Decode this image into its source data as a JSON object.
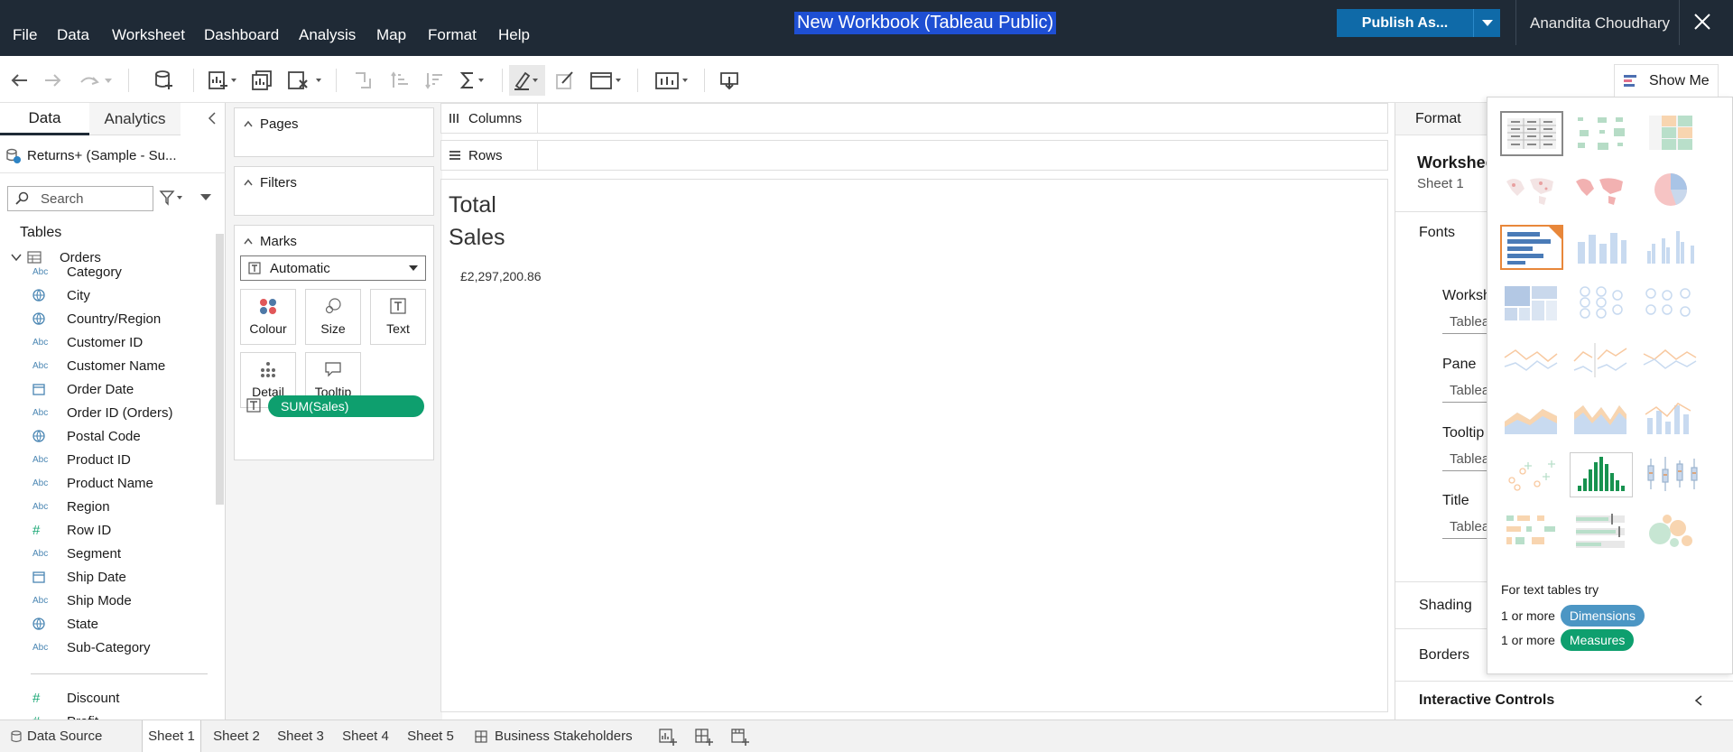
{
  "menu": [
    "File",
    "Data",
    "Worksheet",
    "Dashboard",
    "Analysis",
    "Map",
    "Format",
    "Help"
  ],
  "title": "New Workbook (Tableau Public)",
  "publish_label": "Publish As...",
  "user_name": "Anandita Choudhary",
  "show_me_label": "Show Me",
  "left_tabs": {
    "data": "Data",
    "analytics": "Analytics"
  },
  "datasource": "Returns+ (Sample - Su...",
  "search_placeholder": "Search",
  "tables_label": "Tables",
  "table_name": "Orders",
  "fields": [
    {
      "type": "Abc",
      "name": "Category"
    },
    {
      "type": "globe",
      "name": "City"
    },
    {
      "type": "globe",
      "name": "Country/Region"
    },
    {
      "type": "Abc",
      "name": "Customer ID"
    },
    {
      "type": "Abc",
      "name": "Customer Name"
    },
    {
      "type": "calendar",
      "name": "Order Date"
    },
    {
      "type": "Abc",
      "name": "Order ID (Orders)"
    },
    {
      "type": "globe",
      "name": "Postal Code"
    },
    {
      "type": "Abc",
      "name": "Product ID"
    },
    {
      "type": "Abc",
      "name": "Product Name"
    },
    {
      "type": "Abc",
      "name": "Region"
    },
    {
      "type": "#",
      "name": "Row ID"
    },
    {
      "type": "Abc",
      "name": "Segment"
    },
    {
      "type": "calendar",
      "name": "Ship Date"
    },
    {
      "type": "Abc",
      "name": "Ship Mode"
    },
    {
      "type": "globe",
      "name": "State"
    },
    {
      "type": "Abc",
      "name": "Sub-Category"
    },
    {
      "type": "#",
      "name": "Discount"
    },
    {
      "type": "#",
      "name": "Profit"
    }
  ],
  "cards": {
    "pages": "Pages",
    "filters": "Filters",
    "marks": "Marks",
    "mark_type": "Automatic"
  },
  "mark_buttons": {
    "colour": "Colour",
    "size": "Size",
    "text": "Text",
    "detail": "Detail",
    "tooltip": "Tooltip"
  },
  "pill": "SUM(Sales)",
  "shelves": {
    "columns": "Columns",
    "rows": "Rows"
  },
  "viz": {
    "title": "Total\nSales",
    "value": "£2,297,200.86"
  },
  "format": {
    "header": "Format",
    "worksheet": "Workshee",
    "sheet": "Sheet 1",
    "fonts": "Fonts",
    "worksheet_sub": "Worksh",
    "pane": "Pane",
    "tooltip": "Tooltip",
    "title": "Title",
    "select_value": "Tablea",
    "shading": "Shading",
    "borders": "Borders",
    "interactive": "Interactive Controls"
  },
  "showme": {
    "hint": "For text tables try",
    "dims_prefix": "1 or more",
    "dims": "Dimensions",
    "meas_prefix": "1 or more",
    "meas": "Measures"
  },
  "colors": {
    "topbar": "#1f2a36",
    "publish": "#0f6aa8",
    "pill_green": "#0e9f6e",
    "dims_pill": "#4c96c4",
    "title_highlight": "#1e4fd3"
  },
  "status_tabs": {
    "datasource": "Data Source",
    "sheets": [
      "Sheet 1",
      "Sheet 2",
      "Sheet 3",
      "Sheet 4",
      "Sheet 5"
    ],
    "dashboard": "Business Stakeholders"
  }
}
